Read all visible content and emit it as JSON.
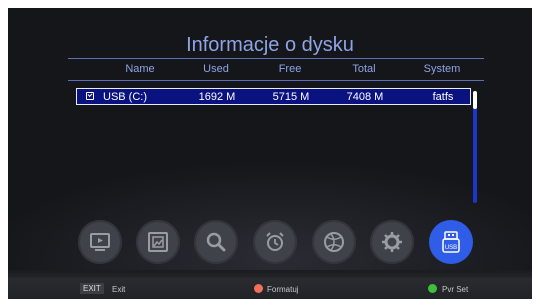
{
  "title": "Informacje o dysku",
  "table": {
    "headers": [
      "Name",
      "Used",
      "Free",
      "Total",
      "System"
    ],
    "rows": [
      {
        "name": "USB (C:)",
        "used": "1692 M",
        "free": "5715 M",
        "total": "7408 M",
        "system": "fatfs",
        "checked": true
      }
    ]
  },
  "toolbar": {
    "icons": [
      "media-player-icon",
      "picture-icon",
      "search-icon",
      "alarm-clock-icon",
      "globe-icon",
      "settings-icon",
      "usb-icon"
    ],
    "active_icon": "usb-icon",
    "usb_icon_label": "USB"
  },
  "footer": {
    "exit_key": "EXIT",
    "exit_label": "Exit",
    "red_label": "Formatuj",
    "green_label": "Pvr Set"
  },
  "colors": {
    "accent": "#8fa3e6",
    "selection": "#0a1280",
    "scrollbar": "#1f34c8",
    "active_icon_bg": "#2f5de8",
    "red_key": "#f0705a",
    "green_key": "#3fbf3a"
  }
}
